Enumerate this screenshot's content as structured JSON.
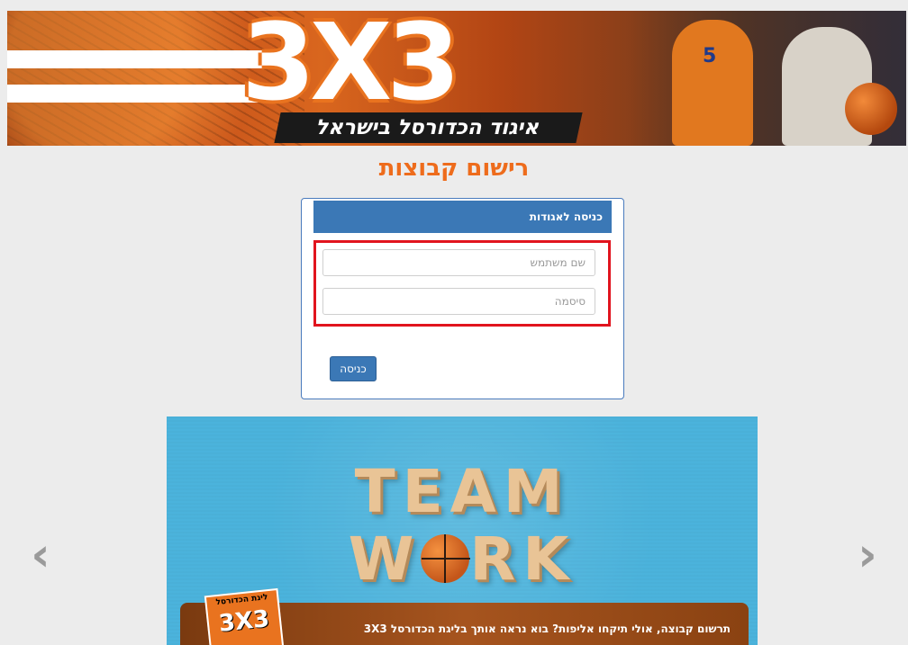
{
  "banner": {
    "logo_text": "3X3",
    "tagline": "איגוד הכדורסל בישראל",
    "jersey_number": "5"
  },
  "page": {
    "title": "רישום קבוצות"
  },
  "login": {
    "header": "כניסה לאגודות",
    "username_placeholder": "שם משתמש",
    "password_placeholder": "סיסמה",
    "submit_label": "כניסה"
  },
  "carousel": {
    "slide_word_1": "TEAM",
    "slide_word_2_prefix": "W",
    "slide_word_2_suffix": "RK",
    "caption": "תרשום קבוצה, אולי תיקחו אליפות? בוא נראה אותך בליגת הכדורסל 3X3",
    "caption_logo_label": "ליגת הכדורסל",
    "caption_logo_number": "3X3",
    "prev_icon": "chevron-left-icon",
    "next_icon": "chevron-right-icon"
  },
  "colors": {
    "accent_orange": "#ee6c1c",
    "panel_blue": "#3b78b6",
    "highlight_red": "#e1141e",
    "slide_blue": "#4bb3dc"
  }
}
